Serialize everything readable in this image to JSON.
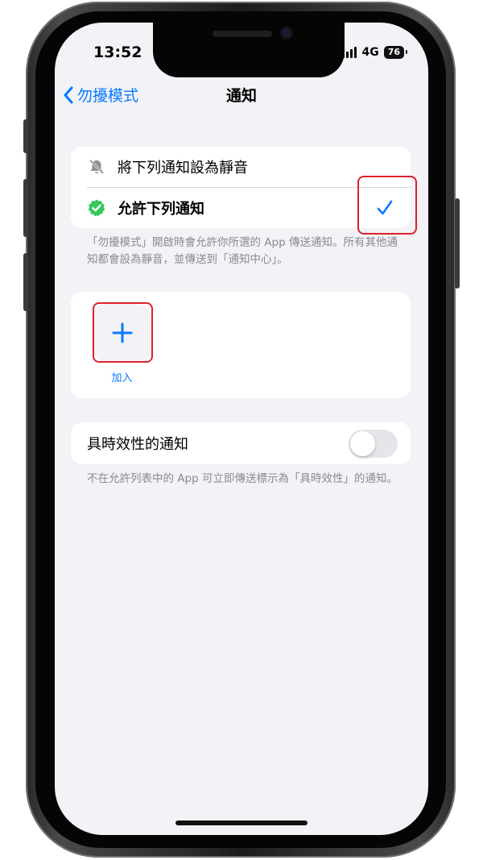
{
  "status_bar": {
    "time": "13:52",
    "network": "4G",
    "battery": "76"
  },
  "nav": {
    "back_label": "勿擾模式",
    "title": "通知"
  },
  "silence_option": {
    "label": "將下列通知設為靜音"
  },
  "allow_option": {
    "label": "允許下列通知",
    "selected": true
  },
  "mode_note": "「勿擾模式」開啟時會允許你所選的 App 傳送通知。所有其他通知都會設為靜音，並傳送到「通知中心」。",
  "add_section": {
    "add_label": "加入"
  },
  "time_sensitive": {
    "label": "具時效性的通知",
    "enabled": false,
    "note": "不在允許列表中的 App 可立即傳送標示為「具時效性」的通知。"
  },
  "colors": {
    "accent": "#0a7aff",
    "green_badge": "#34c759",
    "highlight": "#e0202a",
    "background": "#f2f2f7"
  },
  "icons": [
    "chevron-left-icon",
    "bell-slash-icon",
    "verified-badge-icon",
    "checkmark-icon",
    "plus-icon"
  ]
}
